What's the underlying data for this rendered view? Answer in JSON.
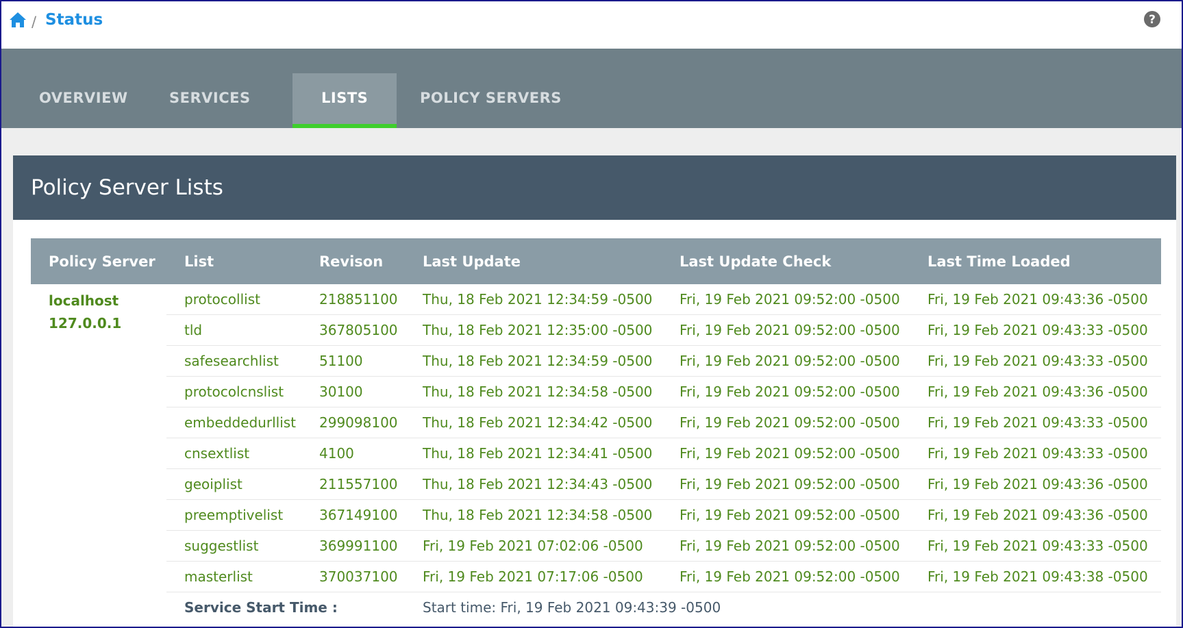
{
  "breadcrumb": {
    "title": "Status",
    "separator": "/"
  },
  "tabs": [
    {
      "label": "OVERVIEW",
      "active": false
    },
    {
      "label": "SERVICES",
      "active": false
    },
    {
      "label": "LISTS",
      "active": true
    },
    {
      "label": "POLICY SERVERS",
      "active": false
    }
  ],
  "panel": {
    "title": "Policy Server Lists"
  },
  "table": {
    "columns": [
      "Policy Server",
      "List",
      "Revison",
      "Last Update",
      "Last Update Check",
      "Last Time Loaded"
    ],
    "server": {
      "name": "localhost",
      "ip": "127.0.0.1"
    },
    "rows": [
      [
        "protocollist",
        "218851100",
        "Thu, 18 Feb 2021 12:34:59 -0500",
        "Fri, 19 Feb 2021 09:52:00 -0500",
        "Fri, 19 Feb 2021 09:43:36 -0500"
      ],
      [
        "tld",
        "367805100",
        "Thu, 18 Feb 2021 12:35:00 -0500",
        "Fri, 19 Feb 2021 09:52:00 -0500",
        "Fri, 19 Feb 2021 09:43:33 -0500"
      ],
      [
        "safesearchlist",
        "51100",
        "Thu, 18 Feb 2021 12:34:59 -0500",
        "Fri, 19 Feb 2021 09:52:00 -0500",
        "Fri, 19 Feb 2021 09:43:33 -0500"
      ],
      [
        "protocolcnslist",
        "30100",
        "Thu, 18 Feb 2021 12:34:58 -0500",
        "Fri, 19 Feb 2021 09:52:00 -0500",
        "Fri, 19 Feb 2021 09:43:36 -0500"
      ],
      [
        "embeddedurllist",
        "299098100",
        "Thu, 18 Feb 2021 12:34:42 -0500",
        "Fri, 19 Feb 2021 09:52:00 -0500",
        "Fri, 19 Feb 2021 09:43:33 -0500"
      ],
      [
        "cnsextlist",
        "4100",
        "Thu, 18 Feb 2021 12:34:41 -0500",
        "Fri, 19 Feb 2021 09:52:00 -0500",
        "Fri, 19 Feb 2021 09:43:33 -0500"
      ],
      [
        "geoiplist",
        "211557100",
        "Thu, 18 Feb 2021 12:34:43 -0500",
        "Fri, 19 Feb 2021 09:52:00 -0500",
        "Fri, 19 Feb 2021 09:43:36 -0500"
      ],
      [
        "preemptivelist",
        "367149100",
        "Thu, 18 Feb 2021 12:34:58 -0500",
        "Fri, 19 Feb 2021 09:52:00 -0500",
        "Fri, 19 Feb 2021 09:43:36 -0500"
      ],
      [
        "suggestlist",
        "369991100",
        "Fri, 19 Feb 2021 07:02:06 -0500",
        "Fri, 19 Feb 2021 09:52:00 -0500",
        "Fri, 19 Feb 2021 09:43:33 -0500"
      ],
      [
        "masterlist",
        "370037100",
        "Fri, 19 Feb 2021 07:17:06 -0500",
        "Fri, 19 Feb 2021 09:52:00 -0500",
        "Fri, 19 Feb 2021 09:43:38 -0500"
      ]
    ],
    "service_start": {
      "label": "Service Start Time :",
      "value": "Start time: Fri, 19 Feb 2021 09:43:39 -0500"
    }
  },
  "colors": {
    "link_blue": "#1e8fe1",
    "tabbar": "#6f8088",
    "active_tab": "#8b9aa1",
    "active_indicator": "#3fcf2d",
    "panel_header": "#46596a",
    "table_header": "#8a9ca6",
    "value_green": "#4f8a1e"
  }
}
